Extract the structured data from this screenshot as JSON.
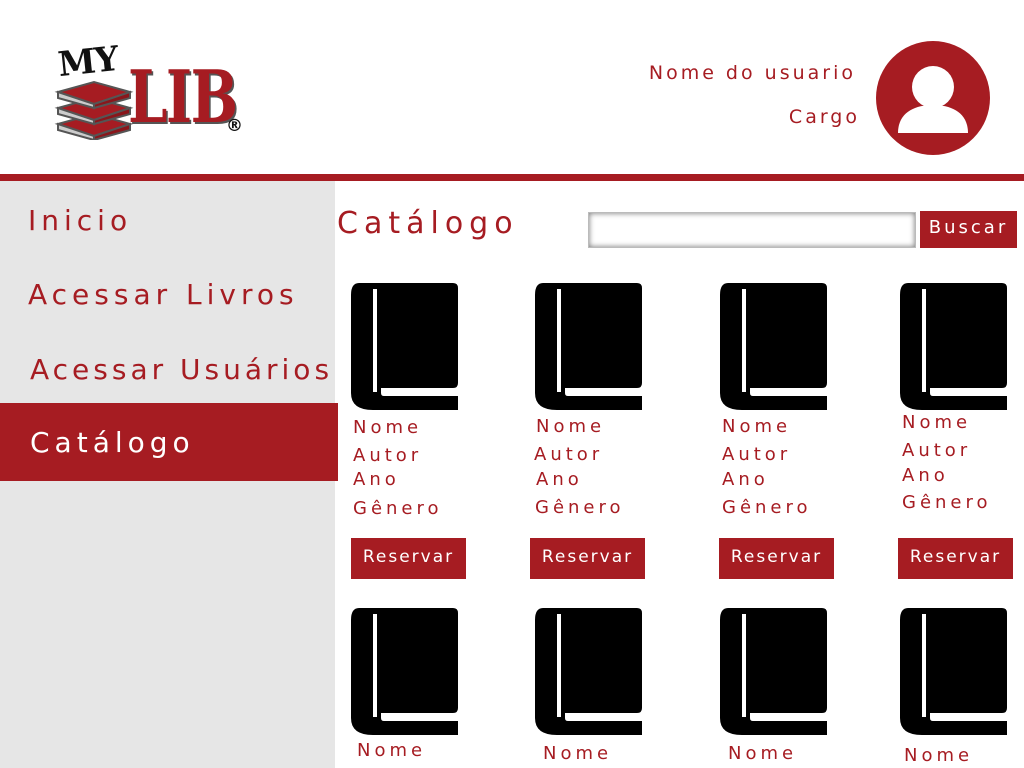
{
  "header": {
    "logo": {
      "prefix": "MY",
      "name": "LIB",
      "mark": "®"
    },
    "user_name": "Nome do usuario",
    "user_role": "Cargo",
    "avatar_icon": "user-avatar-icon"
  },
  "sidebar": {
    "items": [
      {
        "label": "Inicio",
        "active": false
      },
      {
        "label": "Acessar Livros",
        "active": false
      },
      {
        "label": "Acessar Usuários",
        "active": false
      },
      {
        "label": "Catálogo",
        "active": true
      }
    ]
  },
  "main": {
    "title": "Catálogo",
    "search": {
      "value": "",
      "placeholder": "",
      "button_label": "Buscar"
    },
    "books": [
      {
        "name": "Nome",
        "author": "Autor",
        "year": "Ano",
        "genre": "Gênero",
        "button_label": "Reservar"
      },
      {
        "name": "Nome",
        "author": "Autor",
        "year": "Ano",
        "genre": "Gênero",
        "button_label": "Reservar"
      },
      {
        "name": "Nome",
        "author": "Autor",
        "year": "Ano",
        "genre": "Gênero",
        "button_label": "Reservar"
      },
      {
        "name": "Nome",
        "author": "Autor",
        "year": "Ano",
        "genre": "Gênero",
        "button_label": "Reservar"
      },
      {
        "name": "Nome"
      },
      {
        "name": "Nome"
      },
      {
        "name": "Nome"
      },
      {
        "name": "Nome"
      }
    ]
  },
  "colors": {
    "accent": "#a61c22",
    "sidebar_bg": "#e6e6e6",
    "header_bg": "#ffffff",
    "icon": "#000000"
  }
}
